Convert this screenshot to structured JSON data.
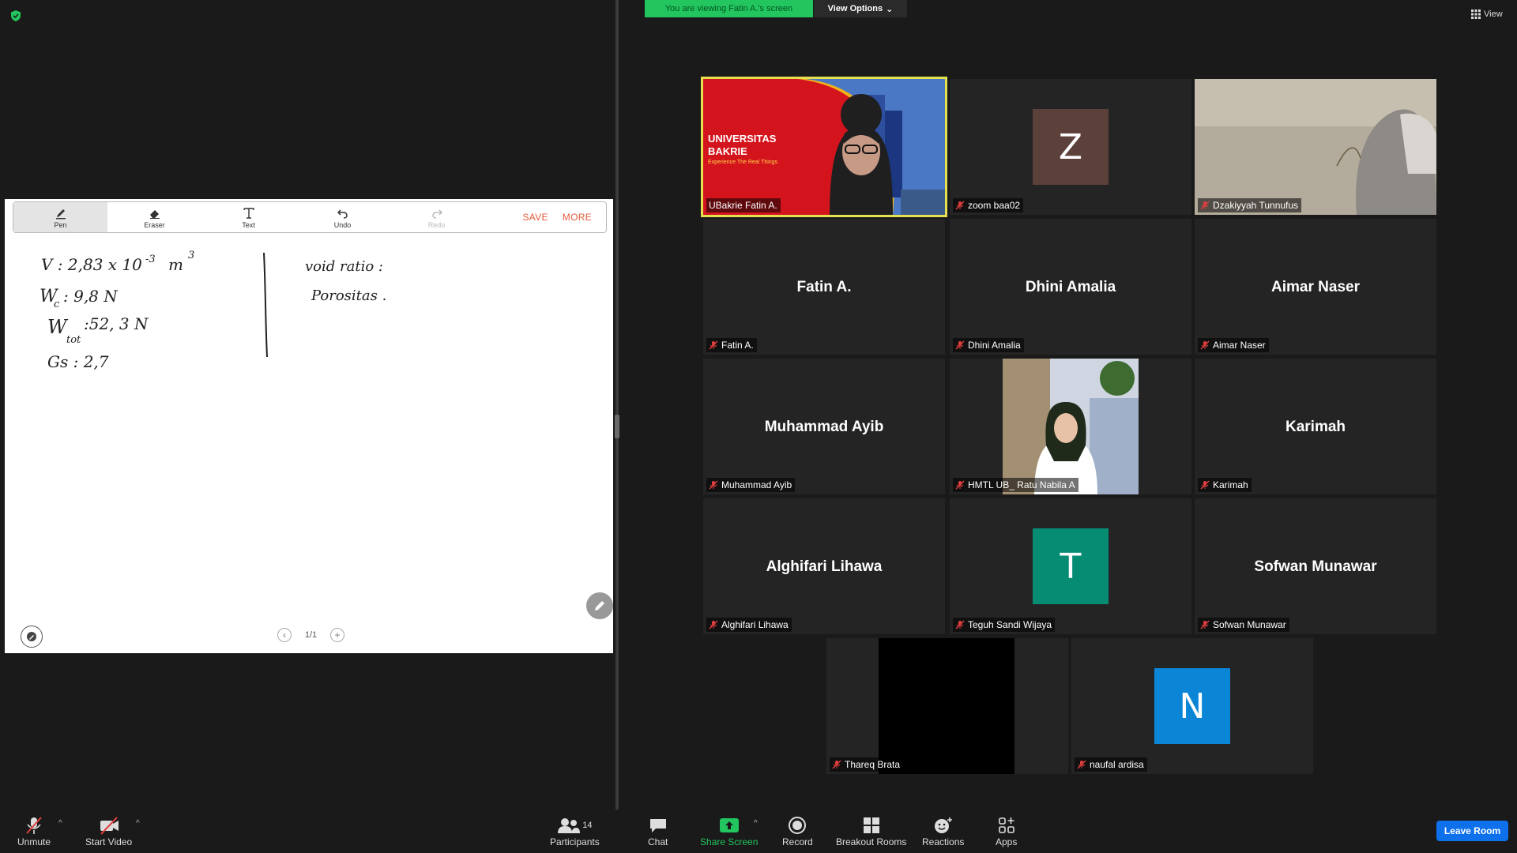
{
  "banner": {
    "viewing": "You are viewing Fatin A.'s screen",
    "view_options": "View Options",
    "view": "View"
  },
  "whiteboard": {
    "tools": [
      {
        "label": "Pen",
        "icon": "pen-icon"
      },
      {
        "label": "Eraser",
        "icon": "eraser-icon"
      },
      {
        "label": "Text",
        "icon": "text-icon"
      },
      {
        "label": "Undo",
        "icon": "undo-icon"
      },
      {
        "label": "Redo",
        "icon": "redo-icon"
      }
    ],
    "save_label": "SAVE",
    "more_label": "MORE",
    "page_label": "1/1",
    "handwriting": {
      "line1": "V : 2,83 x 10",
      "line1_exp": "-3",
      "line1_unit": "m",
      "line1_unit_exp": "3",
      "line2": "W",
      "line2_sub": "c",
      "line2_val": ": 9,8 N",
      "line3": "W",
      "line3_sub": "tot",
      "line3_val": ":52, 3 N",
      "line4": "Gs : 2,7",
      "right1": "void ratio :",
      "right2": "Porositas  ."
    },
    "accent_color": "#e4593b"
  },
  "tiles": [
    {
      "name": "UBakrie Fatin A.",
      "type": "video-bakrie",
      "muted": false
    },
    {
      "name": "zoom baa02",
      "type": "avatar",
      "initial": "Z",
      "color": "#5c403a",
      "muted": true
    },
    {
      "name": "Dzakiyyah Tunnufus",
      "type": "video-room",
      "muted": true
    },
    {
      "name": "Fatin A.",
      "type": "text",
      "display": "Fatin A.",
      "muted": true
    },
    {
      "name": "Dhini Amalia",
      "type": "text",
      "display": "Dhini Amalia",
      "muted": true
    },
    {
      "name": "Aimar Naser",
      "type": "text",
      "display": "Aimar Naser",
      "muted": true
    },
    {
      "name": "Muhammad Ayib",
      "type": "text",
      "display": "Muhammad Ayib",
      "muted": true
    },
    {
      "name": "HMTL UB_ Ratu Nabila A",
      "type": "video-person",
      "muted": true
    },
    {
      "name": "Karimah",
      "type": "text",
      "display": "Karimah",
      "muted": true
    },
    {
      "name": "Alghifari Lihawa",
      "type": "text",
      "display": "Alghifari Lihawa",
      "muted": true
    },
    {
      "name": "Teguh Sandi Wijaya",
      "type": "avatar",
      "initial": "T",
      "color": "#078c74",
      "muted": true
    },
    {
      "name": "Sofwan Munawar",
      "type": "text",
      "display": "Sofwan Munawar",
      "muted": true
    },
    {
      "name": "Thareq Brata",
      "type": "video-black",
      "muted": true
    },
    {
      "name": "naufal ardisa",
      "type": "avatar",
      "initial": "N",
      "color": "#0b86d6",
      "muted": true
    }
  ],
  "bakrie": {
    "line1": "UNIVERSITAS",
    "line2": "BAKRIE",
    "tagline": "Experience The Real Things"
  },
  "toolbar": {
    "unmute": "Unmute",
    "start_video": "Start Video",
    "participants": "Participants",
    "participant_count": "14",
    "chat": "Chat",
    "share_screen": "Share Screen",
    "record": "Record",
    "breakout_rooms": "Breakout Rooms",
    "reactions": "Reactions",
    "apps": "Apps",
    "leave": "Leave Room"
  }
}
